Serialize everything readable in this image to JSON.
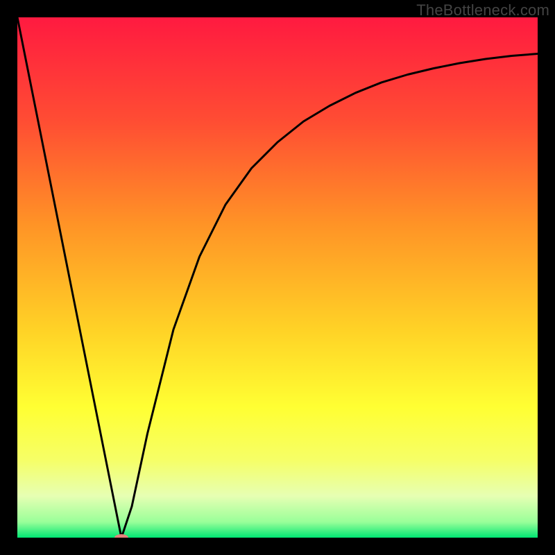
{
  "watermark": "TheBottleneck.com",
  "chart_data": {
    "type": "line",
    "title": "",
    "xlabel": "",
    "ylabel": "",
    "xlim": [
      0,
      100
    ],
    "ylim": [
      0,
      100
    ],
    "grid": false,
    "legend": false,
    "background_gradient_stops": [
      {
        "offset": 0.0,
        "color": "#ff1a40"
      },
      {
        "offset": 0.2,
        "color": "#ff4d33"
      },
      {
        "offset": 0.4,
        "color": "#ff9426"
      },
      {
        "offset": 0.6,
        "color": "#ffd226"
      },
      {
        "offset": 0.75,
        "color": "#ffff33"
      },
      {
        "offset": 0.85,
        "color": "#f6ff66"
      },
      {
        "offset": 0.92,
        "color": "#e6ffb3"
      },
      {
        "offset": 0.97,
        "color": "#99ff99"
      },
      {
        "offset": 1.0,
        "color": "#00e673"
      }
    ],
    "series": [
      {
        "name": "bottleneck-curve",
        "x": [
          0,
          5,
          10,
          15,
          18,
          20,
          22,
          25,
          30,
          35,
          40,
          45,
          50,
          55,
          60,
          65,
          70,
          75,
          80,
          85,
          90,
          95,
          100
        ],
        "y": [
          100,
          75,
          50,
          25,
          10,
          0,
          6,
          20,
          40,
          54,
          64,
          71,
          76,
          80,
          83,
          85.5,
          87.5,
          89,
          90.2,
          91.2,
          92,
          92.6,
          93
        ]
      }
    ],
    "markers": [
      {
        "name": "target-marker",
        "x": 20,
        "y": 0,
        "color": "#e4827c",
        "rx": 10,
        "ry": 5
      }
    ]
  }
}
